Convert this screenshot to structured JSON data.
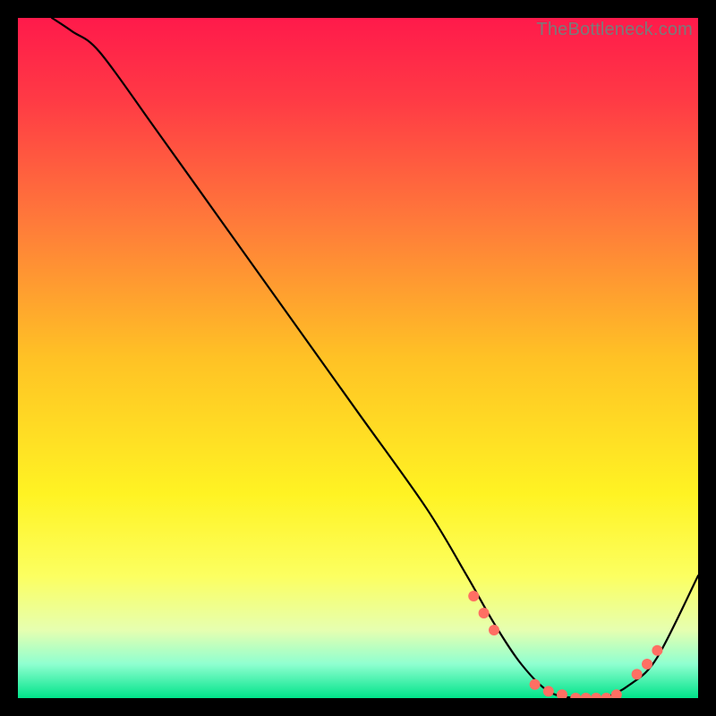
{
  "watermark": "TheBottleneck.com",
  "chart_data": {
    "type": "line",
    "title": "",
    "xlabel": "",
    "ylabel": "",
    "xlim": [
      0,
      100
    ],
    "ylim": [
      0,
      100
    ],
    "grid": false,
    "legend": false,
    "background_gradient": {
      "stops": [
        {
          "offset": 0.0,
          "color": "#ff1a4b"
        },
        {
          "offset": 0.12,
          "color": "#ff3a45"
        },
        {
          "offset": 0.3,
          "color": "#ff7a3a"
        },
        {
          "offset": 0.5,
          "color": "#ffc225"
        },
        {
          "offset": 0.7,
          "color": "#fff323"
        },
        {
          "offset": 0.82,
          "color": "#fcff60"
        },
        {
          "offset": 0.9,
          "color": "#e6ffb0"
        },
        {
          "offset": 0.95,
          "color": "#8fffd0"
        },
        {
          "offset": 1.0,
          "color": "#00e38a"
        }
      ]
    },
    "series": [
      {
        "name": "bottleneck-curve",
        "color": "#000000",
        "x": [
          5,
          8,
          12,
          20,
          30,
          40,
          50,
          60,
          66,
          70,
          74,
          78,
          82,
          86,
          90,
          94,
          100
        ],
        "y": [
          100,
          98,
          95,
          84,
          70,
          56,
          42,
          28,
          18,
          11,
          5,
          1,
          0,
          0,
          2,
          6,
          18
        ]
      }
    ],
    "markers": {
      "name": "highlight-points",
      "color": "#ff6f63",
      "radius": 6,
      "x": [
        67,
        68.5,
        70,
        76,
        78,
        80,
        82,
        83.5,
        85,
        86.5,
        88,
        91,
        92.5,
        94
      ],
      "y": [
        15,
        12.5,
        10,
        2,
        1,
        0.5,
        0,
        0,
        0,
        0,
        0.5,
        3.5,
        5,
        7
      ]
    }
  }
}
